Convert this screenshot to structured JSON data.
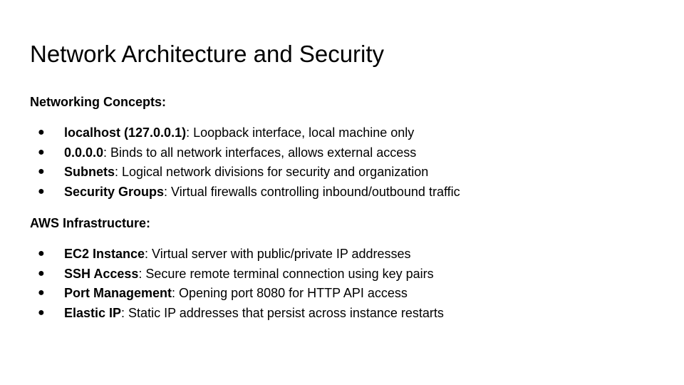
{
  "slide": {
    "title": "Network Architecture and Security",
    "sections": [
      {
        "heading": "Networking Concepts:",
        "items": [
          {
            "term": "localhost (127.0.0.1)",
            "text": ": Loopback interface, local machine only"
          },
          {
            "term": "0.0.0.0",
            "text": ": Binds to all network interfaces, allows external access"
          },
          {
            "term": "Subnets",
            "text": ": Logical network divisions for security and organization"
          },
          {
            "term": "Security Groups",
            "text": ": Virtual firewalls controlling inbound/outbound traffic"
          }
        ]
      },
      {
        "heading": "AWS Infrastructure:",
        "items": [
          {
            "term": "EC2 Instance",
            "text": ": Virtual server with public/private IP addresses"
          },
          {
            "term": "SSH Access",
            "text": ": Secure remote terminal connection using key pairs"
          },
          {
            "term": "Port Management",
            "text": ": Opening port 8080 for HTTP API access"
          },
          {
            "term": "Elastic IP",
            "text": ": Static IP addresses that persist across instance restarts"
          }
        ]
      }
    ],
    "bullet_glyph": "●"
  }
}
